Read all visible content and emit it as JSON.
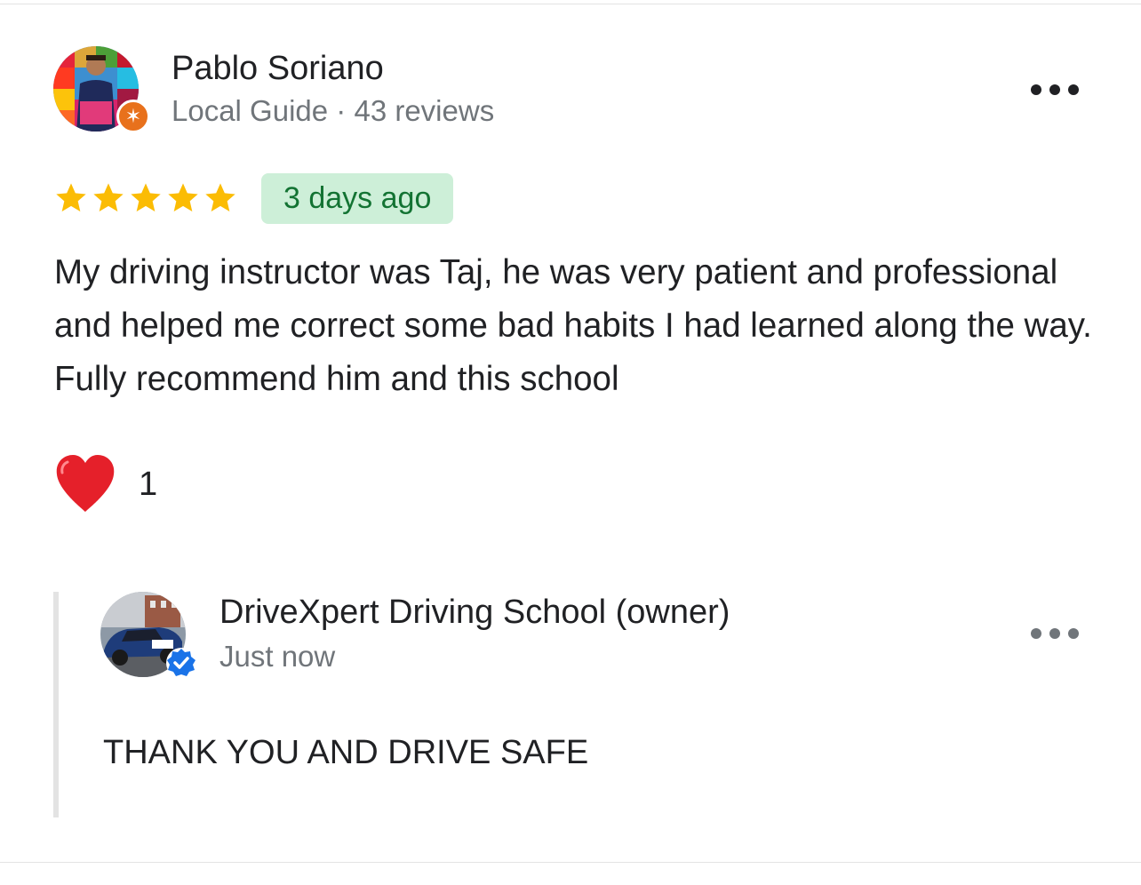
{
  "review": {
    "author": {
      "name": "Pablo Soriano",
      "badge": "Local Guide",
      "reviews_count": "43 reviews",
      "separator": "·",
      "avatar_icon": "user-avatar-photo",
      "badge_icon": "local-guide-star-icon",
      "badge_color": "#e8711c"
    },
    "rating": 5,
    "rating_max": 5,
    "star_color": "#fbbc04",
    "date": "3 days ago",
    "date_pill_bg": "#cdefd8",
    "date_pill_fg": "#137333",
    "text": "My driving instructor was Taj, he was very patient and professional and helped me correct some bad habits I had learned along the way. Fully recommend him and this school",
    "reaction": {
      "icon": "heart-icon",
      "count": "1"
    },
    "more_icon": "more-horiz-icon"
  },
  "owner_reply": {
    "name": "DriveXpert Driving School (owner)",
    "time": "Just now",
    "text": "THANK YOU AND DRIVE SAFE",
    "avatar_icon": "business-avatar-photo",
    "verified_icon": "verified-check-icon",
    "verified_color": "#1a73e8",
    "more_icon": "more-horiz-icon"
  }
}
